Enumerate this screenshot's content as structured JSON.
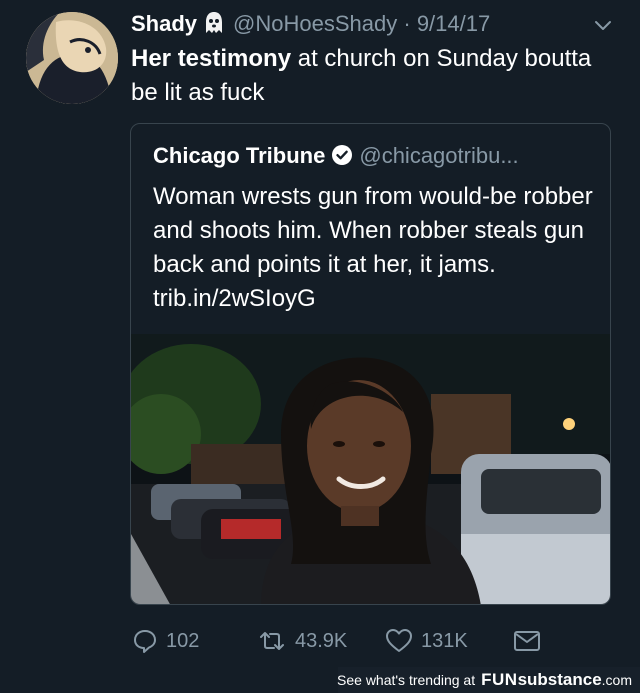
{
  "tweet": {
    "name": "Shady",
    "name_emoji_icon": "ghost-icon",
    "handle": "@NoHoesShady",
    "separator": "·",
    "date": "9/14/17",
    "text_bold": "Her testimony",
    "text_rest": " at church on Sunday boutta be lit as fuck"
  },
  "quote": {
    "name": "Chicago Tribune",
    "verified_icon": "verified-badge-icon",
    "handle": "@chicagotribu...",
    "text": "Woman wrests gun from would-be robber and shoots him. When robber steals gun back and points it at her, it jams. trib.in/2wSIoyG"
  },
  "actions": {
    "reply_count": "102",
    "retweet_count": "43.9K",
    "like_count": "131K"
  },
  "footer": {
    "prefix": "See what's trending at",
    "brand_part1": "FUN",
    "brand_part2": "substance",
    "brand_part3": ".com"
  },
  "colors": {
    "background": "#141d26",
    "muted": "#8899a6",
    "border": "#38444d",
    "text": "#ffffff"
  }
}
